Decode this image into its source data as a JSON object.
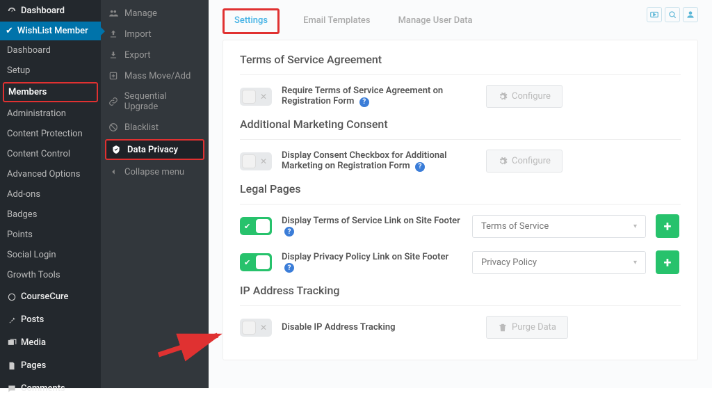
{
  "primary_sidebar": {
    "dashboard": "Dashboard",
    "wlm": "WishList Member",
    "items": [
      "Dashboard",
      "Setup",
      "Members",
      "Administration",
      "Content Protection",
      "Content Control",
      "Advanced Options",
      "Add-ons",
      "Badges",
      "Points",
      "Social Login",
      "Growth Tools"
    ],
    "coursecure": "CourseCure",
    "posts": "Posts",
    "media": "Media",
    "pages": "Pages",
    "comments": "Comments"
  },
  "secondary_sidebar": {
    "items": [
      "Manage",
      "Import",
      "Export",
      "Mass Move/Add",
      "Sequential Upgrade",
      "Blacklist",
      "Data Privacy",
      "Collapse menu"
    ]
  },
  "tabs": [
    "Settings",
    "Email Templates",
    "Manage User Data"
  ],
  "sections": {
    "tos": {
      "title": "Terms of Service Agreement",
      "opt": "Require Terms of Service Agreement on Registration Form",
      "btn": "Configure"
    },
    "consent": {
      "title": "Additional Marketing Consent",
      "opt": "Display Consent Checkbox for Additional Marketing on Registration Form",
      "btn": "Configure"
    },
    "legal": {
      "title": "Legal Pages",
      "opt1": "Display Terms of Service Link on Site Footer",
      "sel1": "Terms of Service",
      "opt2": "Display Privacy Policy Link on Site Footer",
      "sel2": "Privacy Policy"
    },
    "ip": {
      "title": "IP Address Tracking",
      "opt": "Disable IP Address Tracking",
      "btn": "Purge Data"
    }
  }
}
